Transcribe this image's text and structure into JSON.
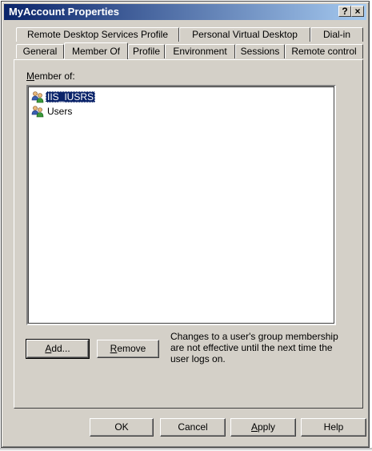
{
  "window": {
    "title": "MyAccount Properties",
    "help_label": "?",
    "close_label": "×"
  },
  "tabs": {
    "row_back": [
      {
        "label": "Remote Desktop Services Profile"
      },
      {
        "label": "Personal Virtual Desktop"
      },
      {
        "label": "Dial-in"
      }
    ],
    "row_front": [
      {
        "label": "General"
      },
      {
        "label": "Member Of",
        "active": true
      },
      {
        "label": "Profile"
      },
      {
        "label": "Environment"
      },
      {
        "label": "Sessions"
      },
      {
        "label": "Remote control"
      }
    ]
  },
  "member_of": {
    "label_prefix": "M",
    "label_rest": "ember of:",
    "groups": [
      {
        "name": "IIS_IUSRS",
        "selected": true,
        "icon": "group-icon"
      },
      {
        "name": "Users",
        "selected": false,
        "icon": "group-icon"
      }
    ]
  },
  "buttons": {
    "add_prefix": "A",
    "add_rest": "dd...",
    "remove_prefix": "R",
    "remove_rest": "emove",
    "ok": "OK",
    "cancel": "Cancel",
    "apply_prefix": "A",
    "apply_rest": "pply",
    "help": "Help"
  },
  "note": "Changes to a user's group membership are not effective until the next time the user logs on."
}
